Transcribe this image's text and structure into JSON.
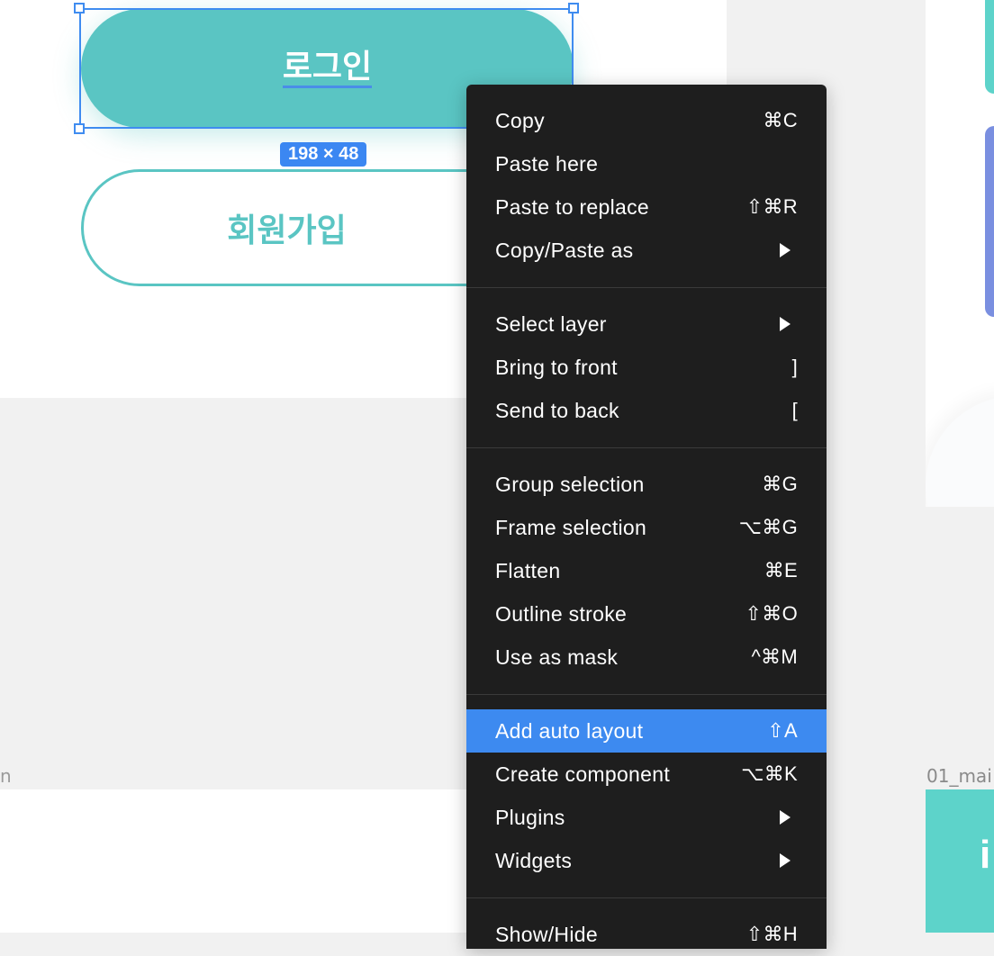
{
  "canvas": {
    "left_frame_label": "n",
    "right_frame_label": "01_mai",
    "right_frame_text": "i"
  },
  "buttons": {
    "login": "로그인",
    "signup": "회원가입",
    "selection_size": "198 × 48"
  },
  "menu": {
    "items": [
      {
        "label": "Copy",
        "shortcut": "⌘C"
      },
      {
        "label": "Paste here",
        "shortcut": ""
      },
      {
        "label": "Paste to replace",
        "shortcut": "⇧⌘R"
      },
      {
        "label": "Copy/Paste as",
        "shortcut": "",
        "submenu": true
      },
      {
        "label": "Select layer",
        "shortcut": "",
        "submenu": true
      },
      {
        "label": "Bring to front",
        "shortcut": "]"
      },
      {
        "label": "Send to back",
        "shortcut": "["
      },
      {
        "label": "Group selection",
        "shortcut": "⌘G"
      },
      {
        "label": "Frame selection",
        "shortcut": "⌥⌘G"
      },
      {
        "label": "Flatten",
        "shortcut": "⌘E"
      },
      {
        "label": "Outline stroke",
        "shortcut": "⇧⌘O"
      },
      {
        "label": "Use as mask",
        "shortcut": "^⌘M"
      },
      {
        "label": "Add auto layout",
        "shortcut": "⇧A",
        "active": true
      },
      {
        "label": "Create component",
        "shortcut": "⌥⌘K"
      },
      {
        "label": "Plugins",
        "shortcut": "",
        "submenu": true
      },
      {
        "label": "Widgets",
        "shortcut": "",
        "submenu": true
      },
      {
        "label": "Show/Hide",
        "shortcut": "⇧⌘H"
      }
    ]
  },
  "colors": {
    "accent_teal": "#5ac5c3",
    "selection_blue": "#3f8cf0",
    "menu_bg": "#1e1e1e",
    "menu_highlight": "#3d8af0"
  }
}
